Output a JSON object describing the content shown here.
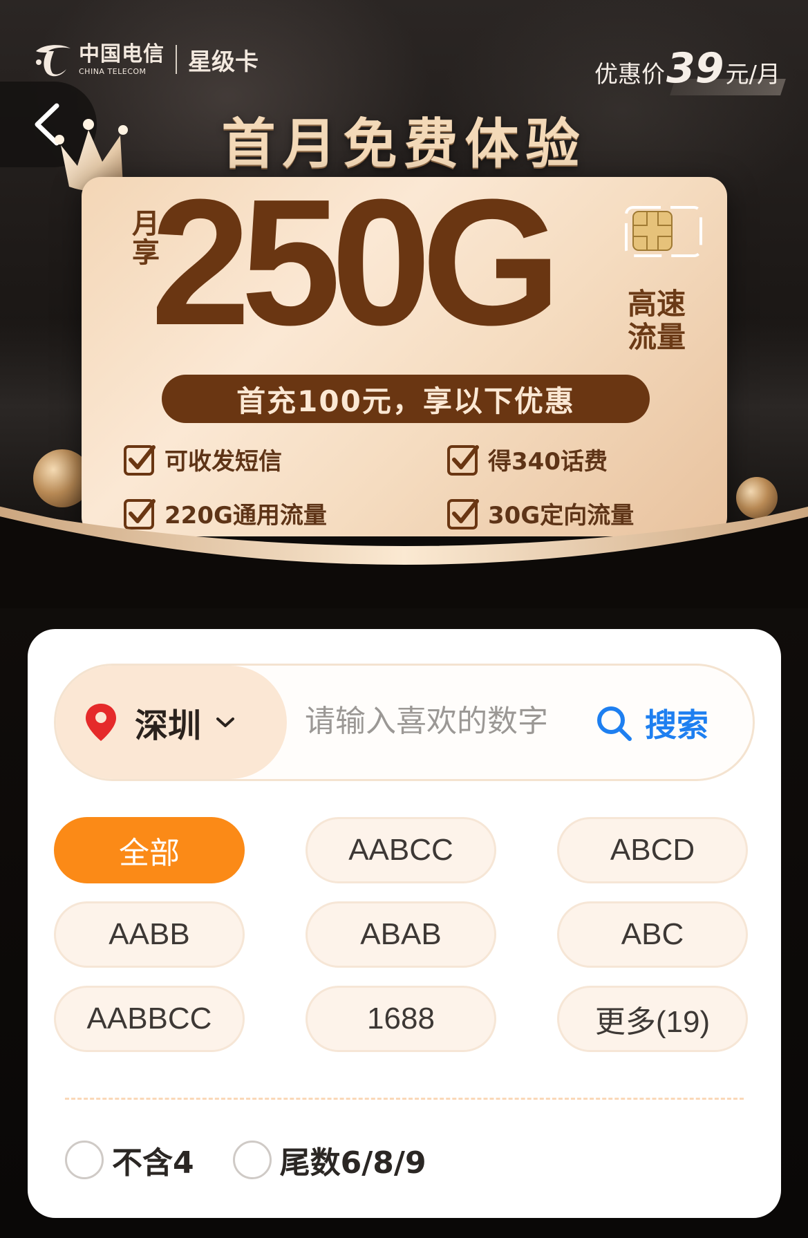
{
  "header": {
    "brand_cn": "中国电信",
    "brand_en": "CHINA TELECOM",
    "card_name": "星级卡",
    "price_label": "优惠价",
    "price_value": "39",
    "price_unit": "元/月",
    "headline": "首月免费体验"
  },
  "promo": {
    "side_label": "月享",
    "data_amount": "250G",
    "speed_label": "高速流量",
    "pill_text": "首充100元，享以下优惠",
    "benefits": [
      "可收发短信",
      "得340话费",
      "220G通用流量",
      "30G定向流量"
    ]
  },
  "search": {
    "city": "深圳",
    "placeholder": "请输入喜欢的数字",
    "button_label": "搜索"
  },
  "tags": [
    "全部",
    "AABCC",
    "ABCD",
    "AABB",
    "ABAB",
    "ABC",
    "AABBCC",
    "1688",
    "更多(19)"
  ],
  "active_tag": "全部",
  "filters": [
    "不含4",
    "尾数6/8/9"
  ],
  "colors": {
    "accent": "#fb8a17",
    "link": "#1e7ff0",
    "brown": "#6a3612",
    "pin": "#e52a2a"
  }
}
